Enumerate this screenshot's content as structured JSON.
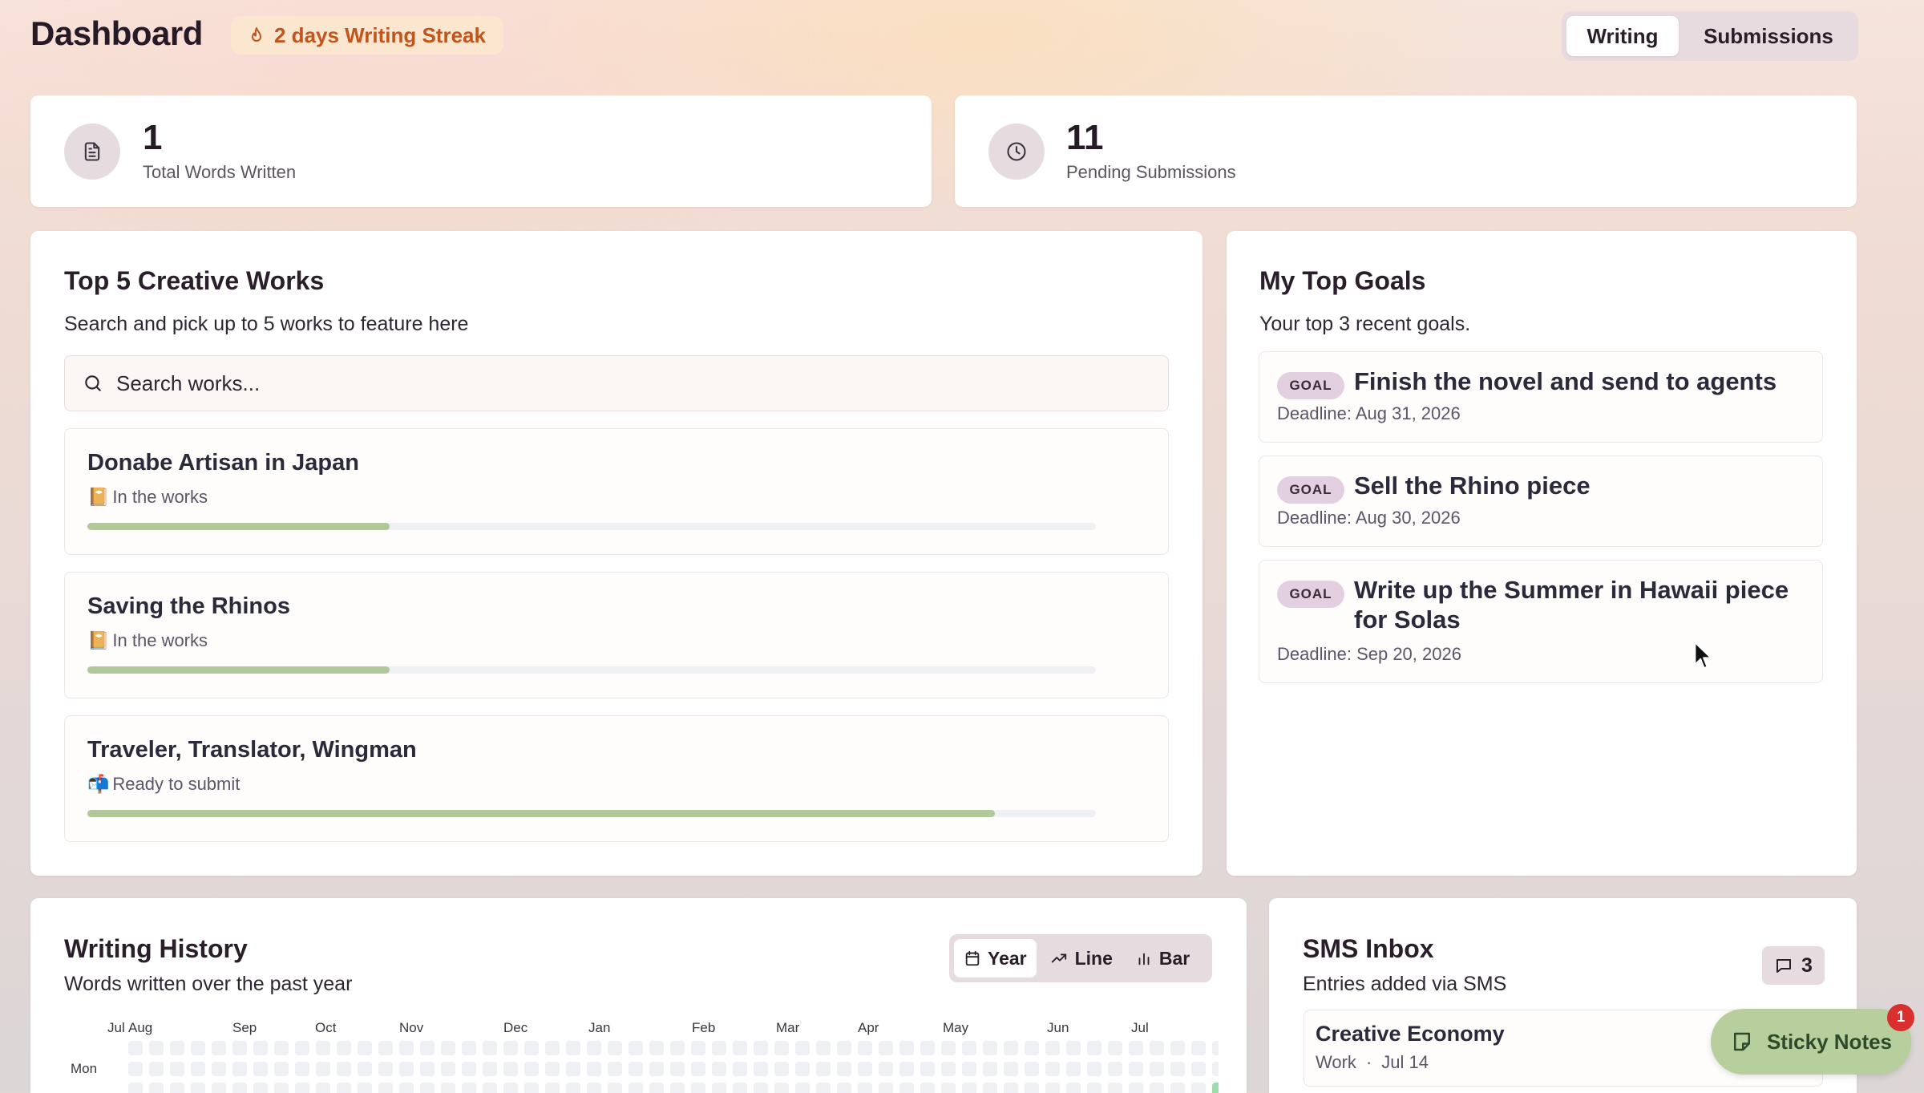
{
  "header": {
    "title": "Dashboard",
    "streak": "2 days Writing Streak",
    "tabs": [
      "Writing",
      "Submissions"
    ]
  },
  "stats": [
    {
      "value": "1",
      "label": "Total Words Written",
      "icon": "document-icon"
    },
    {
      "value": "11",
      "label": "Pending Submissions",
      "icon": "clock-icon"
    }
  ],
  "works": {
    "title": "Top 5 Creative Works",
    "subtitle": "Search and pick up to 5 works to feature here",
    "search_placeholder": "Search works...",
    "items": [
      {
        "title": "Donabe Artisan in Japan",
        "status_icon": "📔",
        "status": "In the works",
        "progress": 0.3
      },
      {
        "title": "Saving the Rhinos",
        "status_icon": "📔",
        "status": "In the works",
        "progress": 0.3
      },
      {
        "title": "Traveler, Translator, Wingman",
        "status_icon": "📬",
        "status": "Ready to submit",
        "progress": 0.9
      }
    ]
  },
  "goals": {
    "title": "My Top Goals",
    "subtitle": "Your top 3 recent goals.",
    "badge": "GOAL",
    "items": [
      {
        "title": "Finish the novel and send to agents",
        "deadline": "Deadline: Aug 31, 2026"
      },
      {
        "title": "Sell the Rhino piece",
        "deadline": "Deadline: Aug 30, 2026"
      },
      {
        "title": "Write up the Summer in Hawaii piece for Solas",
        "deadline": "Deadline: Sep 20, 2026"
      }
    ]
  },
  "history": {
    "title": "Writing History",
    "subtitle": "Words written over the past year",
    "views": [
      "Year",
      "Line",
      "Bar"
    ],
    "active_view": "Year",
    "months": [
      "Jul",
      "Aug",
      "Sep",
      "Oct",
      "Nov",
      "Dec",
      "Jan",
      "Feb",
      "Mar",
      "Apr",
      "May",
      "Jun",
      "Jul"
    ],
    "day_label": "Mon",
    "colors": {
      "empty": "#eef0f3",
      "active": "#9ddcab"
    }
  },
  "sms": {
    "title": "SMS Inbox",
    "subtitle": "Entries added via SMS",
    "count": "3",
    "entries": [
      {
        "title": "Creative Economy",
        "category": "Work",
        "date": "Jul 14"
      }
    ]
  },
  "sticky": {
    "label": "Sticky Notes",
    "badge": "1"
  }
}
